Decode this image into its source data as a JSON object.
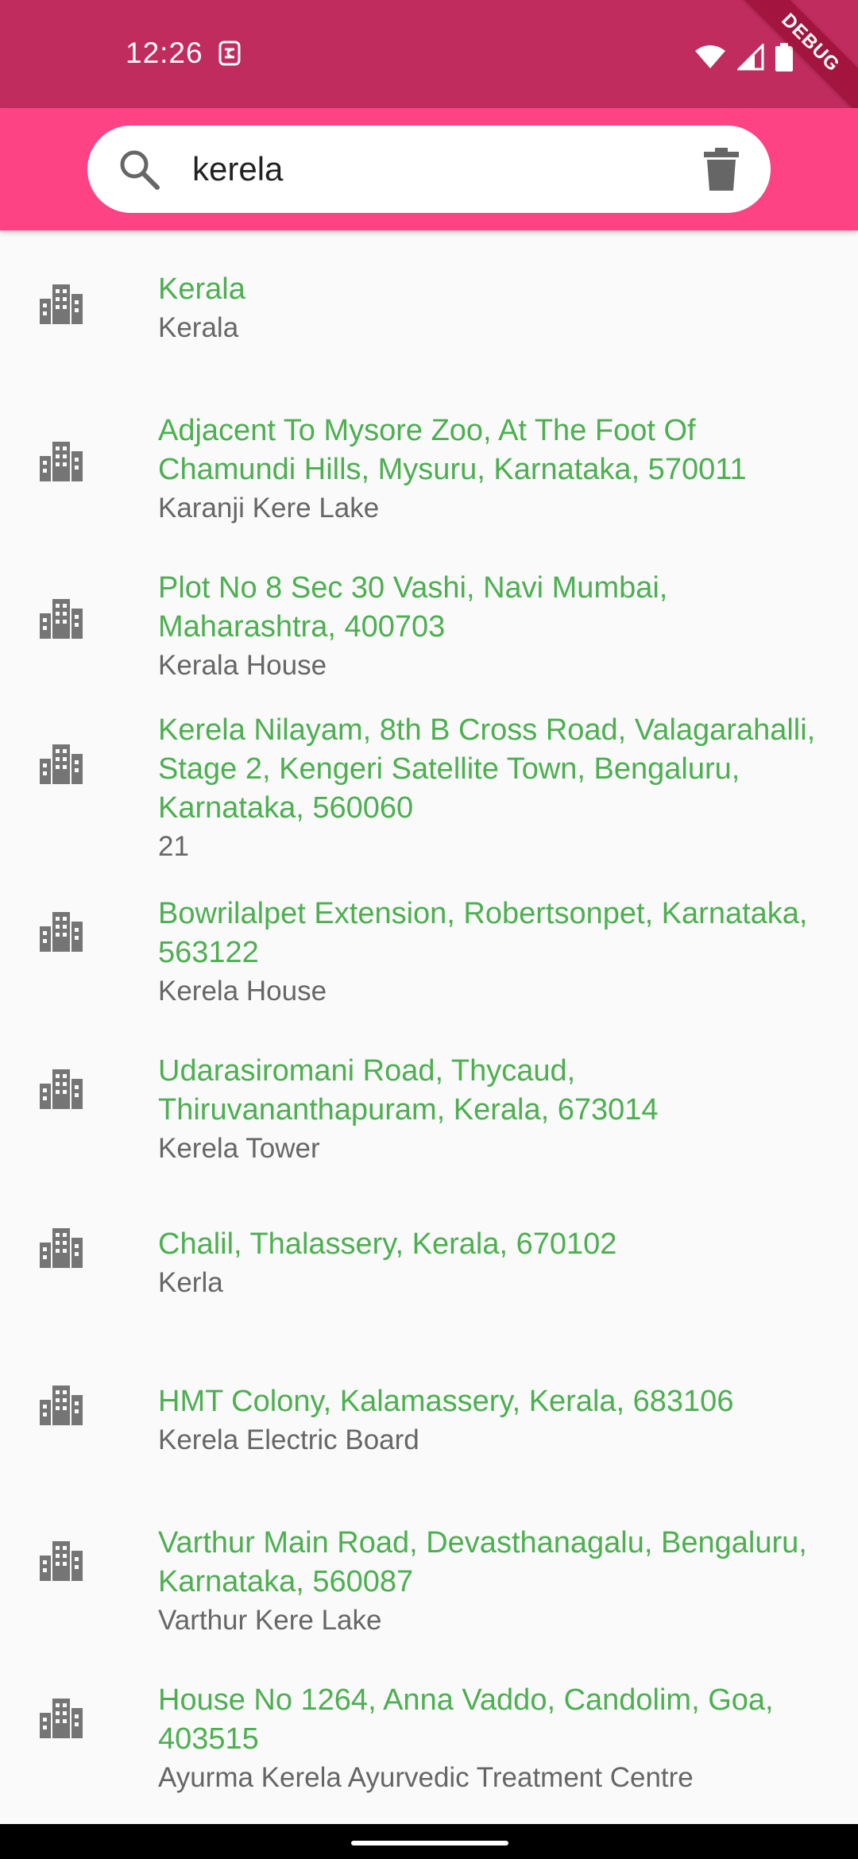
{
  "status_bar": {
    "time": "12:26",
    "debug_label": "DEBUG",
    "background": "#c12c5f"
  },
  "search": {
    "value": "kerela",
    "placeholder": "",
    "search_icon": "search-icon",
    "clear_icon": "delete-icon"
  },
  "theme": {
    "app_bar": "#fd4383",
    "title_color": "#4caf50",
    "subtitle_color": "#666666"
  },
  "results": [
    {
      "title": "Kerala",
      "subtitle": "Kerala",
      "icon": "location-city-icon"
    },
    {
      "title": "Adjacent To Mysore Zoo, At The Foot Of Chamundi Hills, Mysuru, Karnataka, 570011",
      "subtitle": "Karanji Kere Lake",
      "icon": "location-city-icon"
    },
    {
      "title": "Plot No 8 Sec 30 Vashi, Navi Mumbai, Maharashtra, 400703",
      "subtitle": "Kerala House",
      "icon": "location-city-icon"
    },
    {
      "title": "Kerela Nilayam, 8th B Cross Road, Valagarahalli, Stage 2, Kengeri Satellite Town, Bengaluru, Karnataka, 560060",
      "subtitle": "21",
      "icon": "location-city-icon"
    },
    {
      "title": "Bowrilalpet Extension, Robertsonpet, Karnataka, 563122",
      "subtitle": "Kerela House",
      "icon": "location-city-icon"
    },
    {
      "title": "Udarasiromani Road, Thycaud, Thiruvananthapuram, Kerala, 673014",
      "subtitle": "Kerela Tower",
      "icon": "location-city-icon"
    },
    {
      "title": "Chalil, Thalassery, Kerala, 670102",
      "subtitle": "Kerla",
      "icon": "location-city-icon"
    },
    {
      "title": "HMT Colony, Kalamassery, Kerala, 683106",
      "subtitle": "Kerela Electric Board",
      "icon": "location-city-icon"
    },
    {
      "title": "Varthur Main Road, Devasthanagalu, Bengaluru, Karnataka, 560087",
      "subtitle": "Varthur Kere Lake",
      "icon": "location-city-icon"
    },
    {
      "title": "House No 1264, Anna Vaddo, Candolim, Goa, 403515",
      "subtitle": "Ayurma Kerela Ayurvedic Treatment Centre",
      "icon": "location-city-icon"
    }
  ]
}
